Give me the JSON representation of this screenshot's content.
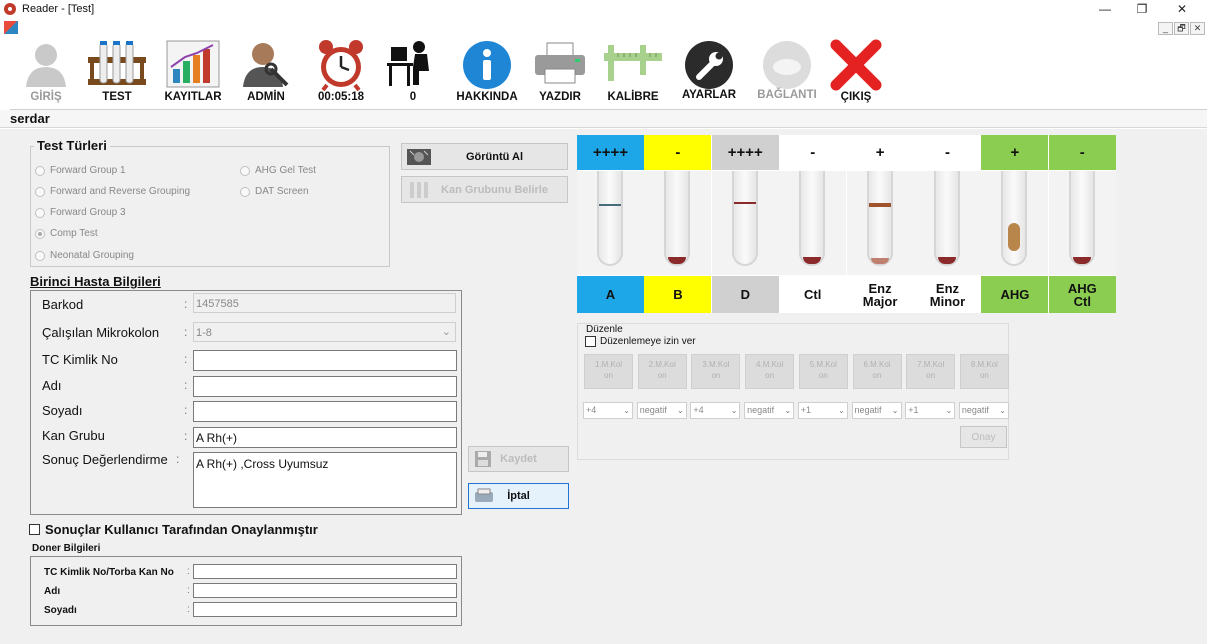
{
  "window": {
    "title": "Reader - [Test]",
    "minimize": "—",
    "restore": "❐",
    "close": "✕"
  },
  "mdi": {
    "minimize": "_",
    "restore": "🗗",
    "close": "✕"
  },
  "toolbar": {
    "login": "GİRİŞ",
    "test": "TEST",
    "records": "KAYITLAR",
    "admin": "ADMİN",
    "timer": "00:05:18",
    "count": "0",
    "about": "HAKKINDA",
    "print": "YAZDIR",
    "calibrate": "KALİBRE",
    "settings": "AYARLAR",
    "connection": "BAĞLANTI",
    "exit": "ÇIKIŞ"
  },
  "user": "serdar",
  "test_types": {
    "legend": "Test Türleri",
    "items": [
      "Forward Group 1",
      "Forward and Reverse Grouping",
      "Forward Group 3",
      "Comp Test",
      "Neonatal Grouping",
      "AHG Gel Test",
      "DAT Screen"
    ],
    "selected": "Comp Test"
  },
  "actions": {
    "capture": "Görüntü Al",
    "determine": "Kan Grubunu Belirle",
    "save": "Kaydet",
    "cancel": "İptal"
  },
  "patient": {
    "legend": "Birinci Hasta Bilgileri",
    "barcode_label": "Barkod",
    "barcode": "1457585",
    "microcolumn_label": "Çalışılan Mikrokolon",
    "microcolumn": "1-8",
    "tc_label": "TC Kimlik No",
    "tc": "",
    "name_label": "Adı",
    "name": "",
    "surname_label": "Soyadı",
    "surname": "",
    "blood_label": "Kan Grubu",
    "blood": "A Rh(+)",
    "result_label": "Sonuç Değerlendirme",
    "result": "A Rh(+) ,Cross Uyumsuz",
    "colon": ":"
  },
  "approved": {
    "label": "Sonuçlar Kullanıcı Tarafından Onaylanmıştır",
    "checked": false
  },
  "donor": {
    "legend": "Doner Bilgileri",
    "tc_label": "TC Kimlik No/Torba Kan No",
    "name_label": "Adı",
    "surname_label": "Soyadı",
    "colon": ":"
  },
  "columns": [
    {
      "result": "++++",
      "name": "A",
      "color": "#1ea7e8",
      "pellet": "top"
    },
    {
      "result": "-",
      "name": "B",
      "color": "#ffff00",
      "pellet": "bottom"
    },
    {
      "result": "++++",
      "name": "D",
      "color": "#d0d0d0",
      "pellet": "top"
    },
    {
      "result": "-",
      "name": "Ctl",
      "color": "#ffffff",
      "pellet": "bottom"
    },
    {
      "result": "+",
      "name": "Enz\nMajor",
      "color": "#ffffff",
      "pellet": "mid"
    },
    {
      "result": "-",
      "name": "Enz\nMinor",
      "color": "#ffffff",
      "pellet": "bottom"
    },
    {
      "result": "+",
      "name": "AHG",
      "color": "#8bcd50",
      "pellet": "spread"
    },
    {
      "result": "-",
      "name": "AHG\nCtl",
      "color": "#8bcd50",
      "pellet": "bottom"
    }
  ],
  "edit": {
    "legend": "Düzenle",
    "allow_label": "Düzenlemeye izin ver",
    "allow": false,
    "columns": [
      {
        "k": "1.M.Kol",
        "s": "on"
      },
      {
        "k": "2.M.Kol",
        "s": "on"
      },
      {
        "k": "3.M.Kol",
        "s": "on"
      },
      {
        "k": "4.M.Kol",
        "s": "on"
      },
      {
        "k": "5.M.Kol",
        "s": "on"
      },
      {
        "k": "6.M.Kol",
        "s": "on"
      },
      {
        "k": "7.M.Kol",
        "s": "on"
      },
      {
        "k": "8.M.Kol",
        "s": "on"
      }
    ],
    "selects": [
      "+4",
      "negatif",
      "+4",
      "negatif",
      "+1",
      "negatif",
      "+1",
      "negatif"
    ],
    "confirm": "Onay"
  }
}
